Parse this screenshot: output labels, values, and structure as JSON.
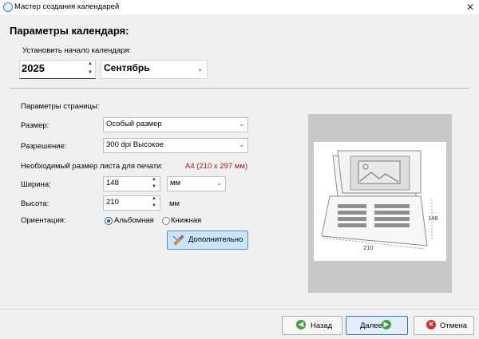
{
  "window": {
    "title": "Мастер создания календарей",
    "close_glyph": "✕"
  },
  "heading": "Параметры календаря:",
  "start": {
    "label": "Установить начало календаря:",
    "year": "2025",
    "month": "Сентябрь"
  },
  "page": {
    "section_label": "Параметры страницы:",
    "size_label": "Размер:",
    "size_value": "Особый размер",
    "resolution_label": "Разрешение:",
    "resolution_value": "300 dpi Высокое",
    "required_label": "Необходимый размер листа для печати:",
    "required_value": "A4 (210 x 297 мм)",
    "width_label": "Ширина:",
    "width_value": "148",
    "unit_select": "мм",
    "height_label": "Высота:",
    "height_value": "210",
    "height_unit": "мм",
    "orientation_label": "Ориентация:",
    "orientation_landscape": "Альбомная",
    "orientation_portrait": "Книжная",
    "orientation_selected": "landscape",
    "advanced_button": "Дополнительно"
  },
  "preview": {
    "height_dim": "148",
    "width_dim": "210"
  },
  "footer": {
    "back": "Назад",
    "next": "Далее",
    "cancel": "Отмена"
  },
  "colors": {
    "accent": "#2f7bd3",
    "back_green": "#3aa33a",
    "cancel_red": "#d32f2f",
    "required_red": "#a31515"
  }
}
